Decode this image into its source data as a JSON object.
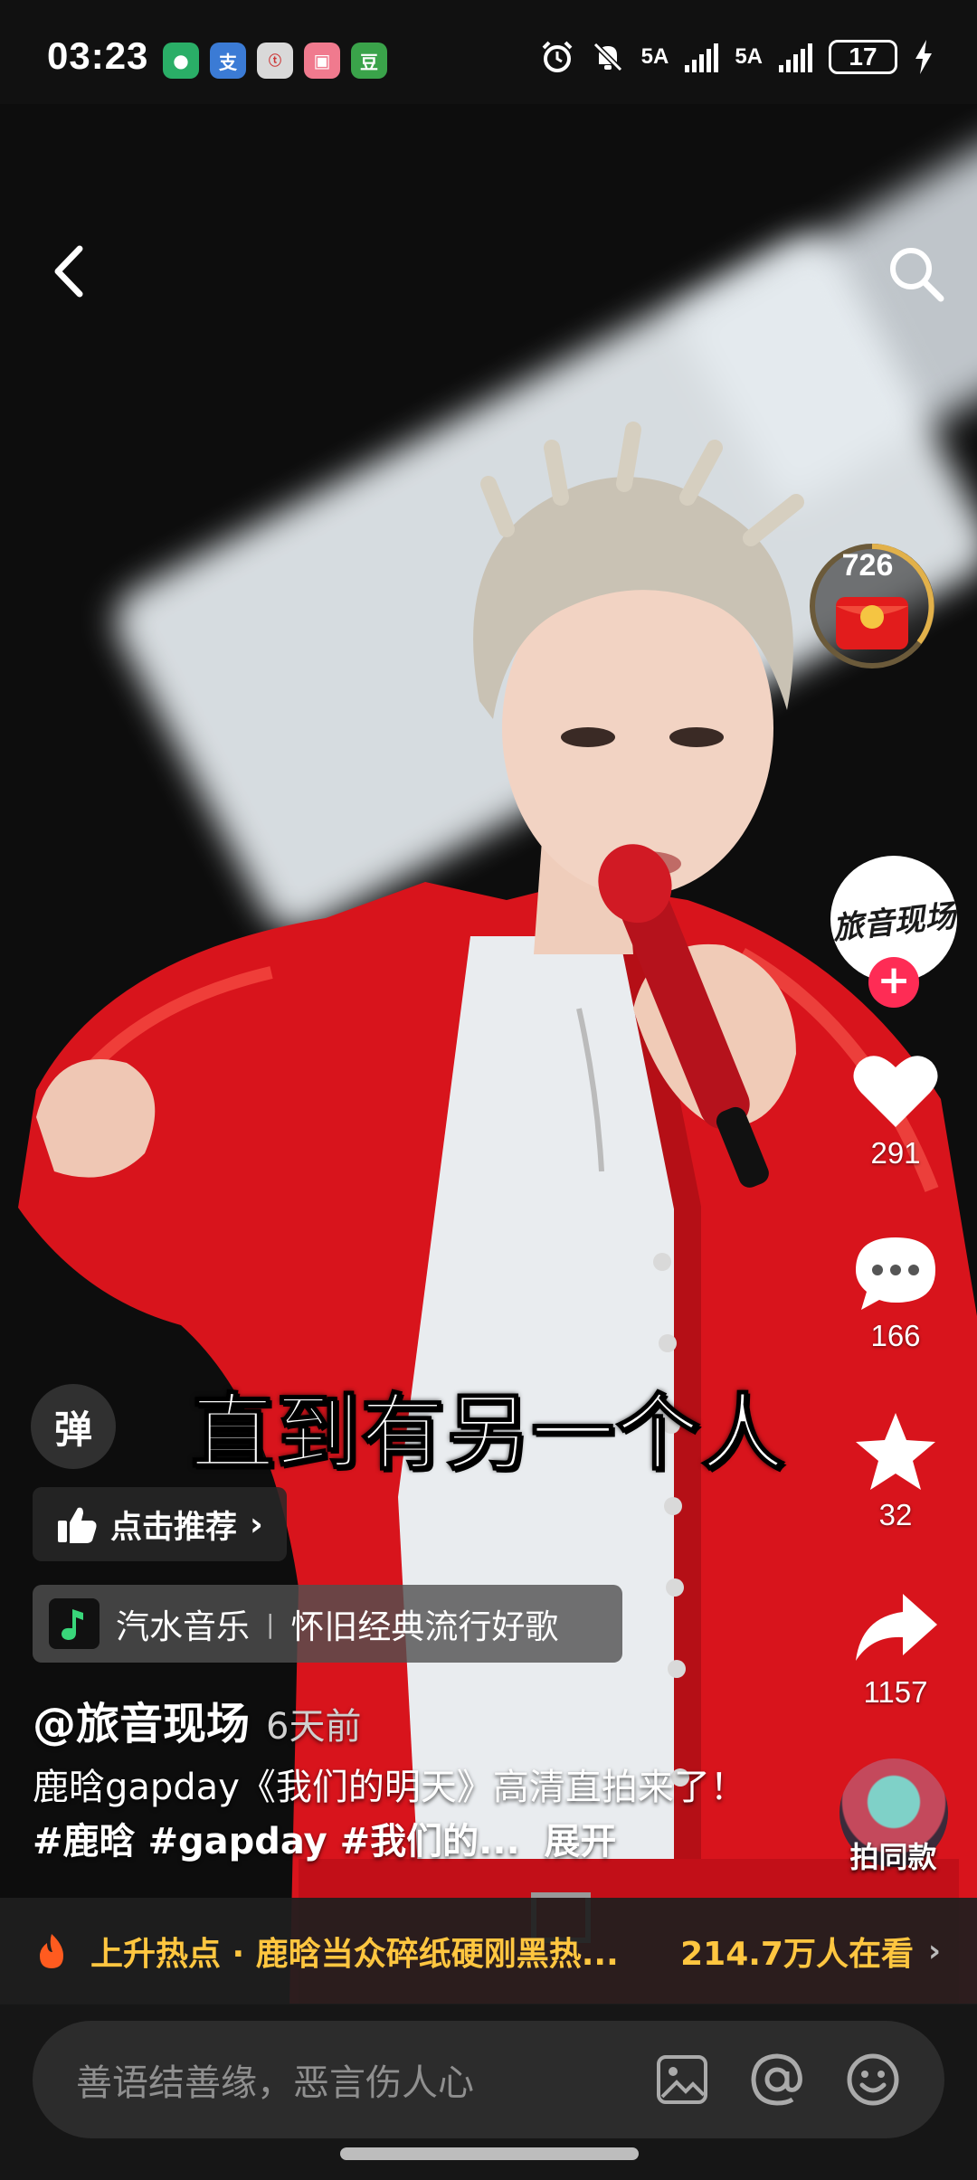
{
  "status_bar": {
    "time": "03:23",
    "apps": [
      {
        "icon": "wechat-icon",
        "glyph": "●",
        "bg": "#2aae67"
      },
      {
        "icon": "alipay-icon",
        "glyph": "支",
        "bg": "#3b7bd5"
      },
      {
        "icon": "taobao-icon",
        "glyph": "ⓣ",
        "bg": "#d9d9d9"
      },
      {
        "icon": "shopping-bag-icon",
        "glyph": "▣",
        "bg": "#f07a8e"
      },
      {
        "icon": "douban-icon",
        "glyph": "豆",
        "bg": "#3aa34a"
      }
    ],
    "net_label_1": "5A",
    "net_label_2": "5A",
    "battery": "17"
  },
  "video": {
    "subtitle": "直到有另一个人"
  },
  "right_rail": {
    "red_packet_count": "726",
    "creator_avatar_text": "旅音现场",
    "follow_symbol": "+",
    "likes": "291",
    "comments": "166",
    "favorites": "32",
    "shares": "1157",
    "same_style_label": "拍同款"
  },
  "overlay": {
    "danmu_label": "弹",
    "recommend_label": "点击推荐",
    "music_app": "汽水音乐",
    "music_playlist": "怀旧经典流行好歌",
    "author": "@旅音现场",
    "posted": "6天前",
    "caption_text": "鹿晗gapday《我们的明天》高清直拍来了！",
    "caption_tags": "#鹿晗 #gapday #我们的...",
    "expand_label": "展开"
  },
  "hot_bar": {
    "topic": "上升热点 · 鹿晗当众碎纸硬刚黑热...",
    "viewers": "214.7万人在看"
  },
  "comment_input": {
    "placeholder": "善语结善缘，恶言伤人心"
  },
  "colors": {
    "accent_pink": "#fe2c55",
    "hot_yellow": "#ffc640",
    "jacket_red": "#d8141c"
  }
}
